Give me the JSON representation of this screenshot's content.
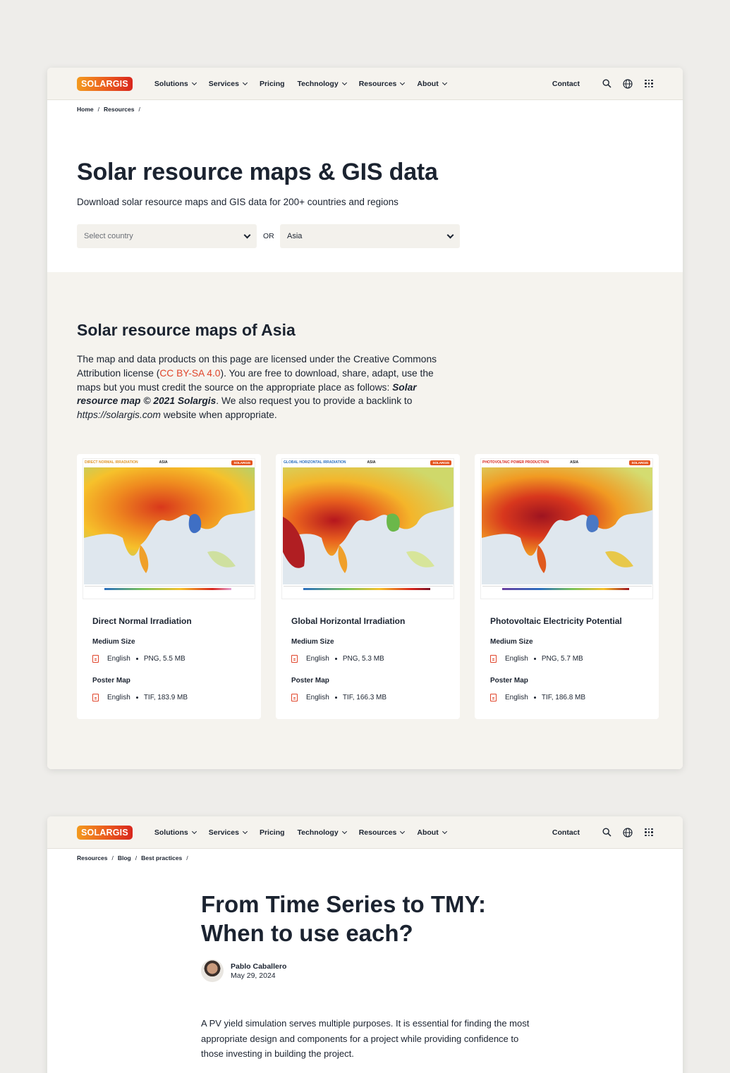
{
  "nav": {
    "logo": "SOLARGIS",
    "items": [
      "Solutions",
      "Services",
      "Pricing",
      "Technology",
      "Resources",
      "About"
    ],
    "contact": "Contact"
  },
  "page1": {
    "breadcrumb": [
      "Home",
      "Resources"
    ],
    "title": "Solar resource maps & GIS data",
    "subtitle": "Download solar resource maps and GIS data for 200+ countries and regions",
    "country_placeholder": "Select country",
    "or_label": "OR",
    "region_value": "Asia",
    "section_title": "Solar resource maps of Asia",
    "license": {
      "p1": "The map and data products on this page are licensed under the Creative Commons Attribution license (",
      "link": "CC BY-SA 4.0",
      "p2": "). You are free to download, share, adapt, use the maps but you must credit the source on the appropriate place as follows: ",
      "credit": "Solar resource map © 2021 Solargis",
      "p3": ". We also request you to provide a backlink to ",
      "url": "https://solargis.com",
      "p4": " website when appropriate."
    },
    "cards": [
      {
        "thumb_label": "DIRECT NORMAL IRRADIATION",
        "thumb_region": "ASIA",
        "thumb_color": "#e0962b",
        "title": "Direct Normal Irradiation",
        "medium_label": "Medium Size",
        "medium_lang": "English",
        "medium_file": "PNG, 5.5 MB",
        "poster_label": "Poster Map",
        "poster_lang": "English",
        "poster_file": "TIF, 183.9 MB"
      },
      {
        "thumb_label": "GLOBAL HORIZONTAL IRRADIATION",
        "thumb_region": "ASIA",
        "thumb_color": "#2b6fc0",
        "title": "Global Horizontal Irradiation",
        "medium_label": "Medium Size",
        "medium_lang": "English",
        "medium_file": "PNG, 5.3 MB",
        "poster_label": "Poster Map",
        "poster_lang": "English",
        "poster_file": "TIF, 166.3 MB"
      },
      {
        "thumb_label": "PHOTOVOLTAIC POWER PRODUCTION",
        "thumb_region": "ASIA",
        "thumb_color": "#d8261d",
        "title": "Photovoltaic Electricity Potential",
        "medium_label": "Medium Size",
        "medium_lang": "English",
        "medium_file": "PNG, 5.7 MB",
        "poster_label": "Poster Map",
        "poster_lang": "English",
        "poster_file": "TIF, 186.8 MB"
      }
    ]
  },
  "page2": {
    "breadcrumb": [
      "Resources",
      "Blog",
      "Best practices"
    ],
    "title": "From Time Series to TMY: When to use each?",
    "author_name": "Pablo Caballero",
    "author_date": "May 29, 2024",
    "intro": "A PV yield simulation serves multiple purposes. It is essential for finding the most appropriate design and components for a project while providing confidence to those investing in building the project."
  },
  "colors": {
    "accent": "#e0452b",
    "dark_text": "#1b2330",
    "beige": "#f5f3ee"
  }
}
